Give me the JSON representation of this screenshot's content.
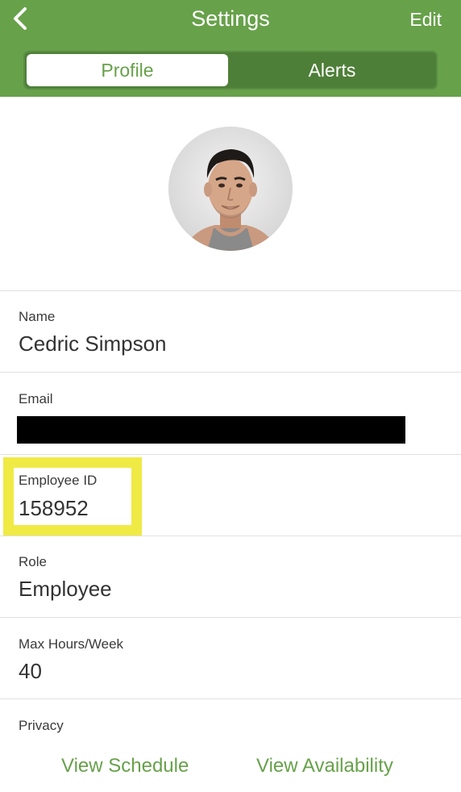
{
  "header": {
    "title": "Settings",
    "edit_label": "Edit",
    "tabs": [
      "Profile",
      "Alerts"
    ],
    "active_tab": "Profile",
    "color": "#67a14a"
  },
  "profile": {
    "fields": [
      {
        "label": "Name",
        "value": "Cedric Simpson"
      },
      {
        "label": "Email",
        "value": ""
      },
      {
        "label": "Employee ID",
        "value": "158952"
      },
      {
        "label": "Role",
        "value": "Employee"
      },
      {
        "label": "Max Hours/Week",
        "value": "40"
      },
      {
        "label": "Privacy",
        "value": ""
      }
    ]
  },
  "footer": {
    "view_schedule": "View Schedule",
    "view_availability": "View Availability"
  }
}
